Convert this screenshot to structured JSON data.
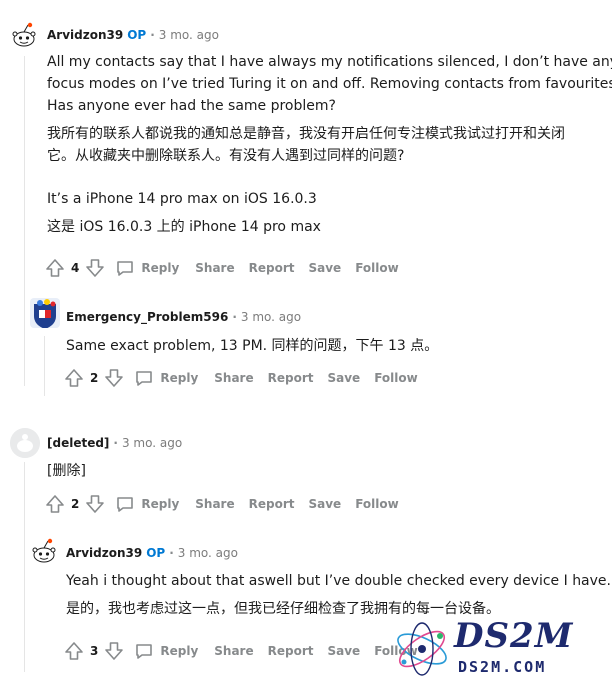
{
  "comments": [
    {
      "author": "Arvidzon39",
      "op_badge": "OP",
      "time": "3 mo. ago",
      "lines": [
        "All my contacts say that I have always my notifications silenced, I don’t have any",
        "focus modes on I’ve tried Turing it on and off. Removing contacts from favourites.",
        "Has anyone ever had the same problem?",
        "我所有的联系人都说我的通知总是静音，我没有开启任何专注模式我试过打开和关闭",
        "它。从收藏夹中删除联系人。有没有人遇到过同样的问题?",
        "It’s a iPhone 14 pro max on iOS 16.0.3",
        "这是 iOS 16.0.3 上的 iPhone 14 pro max"
      ],
      "votes": "4",
      "actions": {
        "reply": "Reply",
        "share": "Share",
        "report": "Report",
        "save": "Save",
        "follow": "Follow"
      }
    },
    {
      "author": "Emergency_Problem596",
      "time": "3 mo. ago",
      "lines": [
        "Same exact problem, 13 PM. 同样的问题，下午 13 点。"
      ],
      "votes": "2",
      "actions": {
        "reply": "Reply",
        "share": "Share",
        "report": "Report",
        "save": "Save",
        "follow": "Follow"
      }
    },
    {
      "author": "[deleted]",
      "time": "3 mo. ago",
      "lines": [
        "[删除]"
      ],
      "votes": "2",
      "actions": {
        "reply": "Reply",
        "share": "Share",
        "report": "Report",
        "save": "Save",
        "follow": "Follow"
      }
    },
    {
      "author": "Arvidzon39",
      "op_badge": "OP",
      "time": "3 mo. ago",
      "lines": [
        "Yeah i thought about that aswell but I’ve double checked every device I have.",
        "是的，我也考虑过这一点，但我已经仔细检查了我拥有的每一台设备。"
      ],
      "votes": "3",
      "actions": {
        "reply": "Reply",
        "share": "Share",
        "report": "Report",
        "save": "Save",
        "follow": "Follow"
      }
    }
  ],
  "watermark": {
    "logo": "DS2M",
    "site": "DS2M.COM"
  },
  "colors": {
    "op": "#0079d3",
    "meta": "#878a8c",
    "thread": "#e5e5e5",
    "watermark": "#1e2a6e"
  }
}
